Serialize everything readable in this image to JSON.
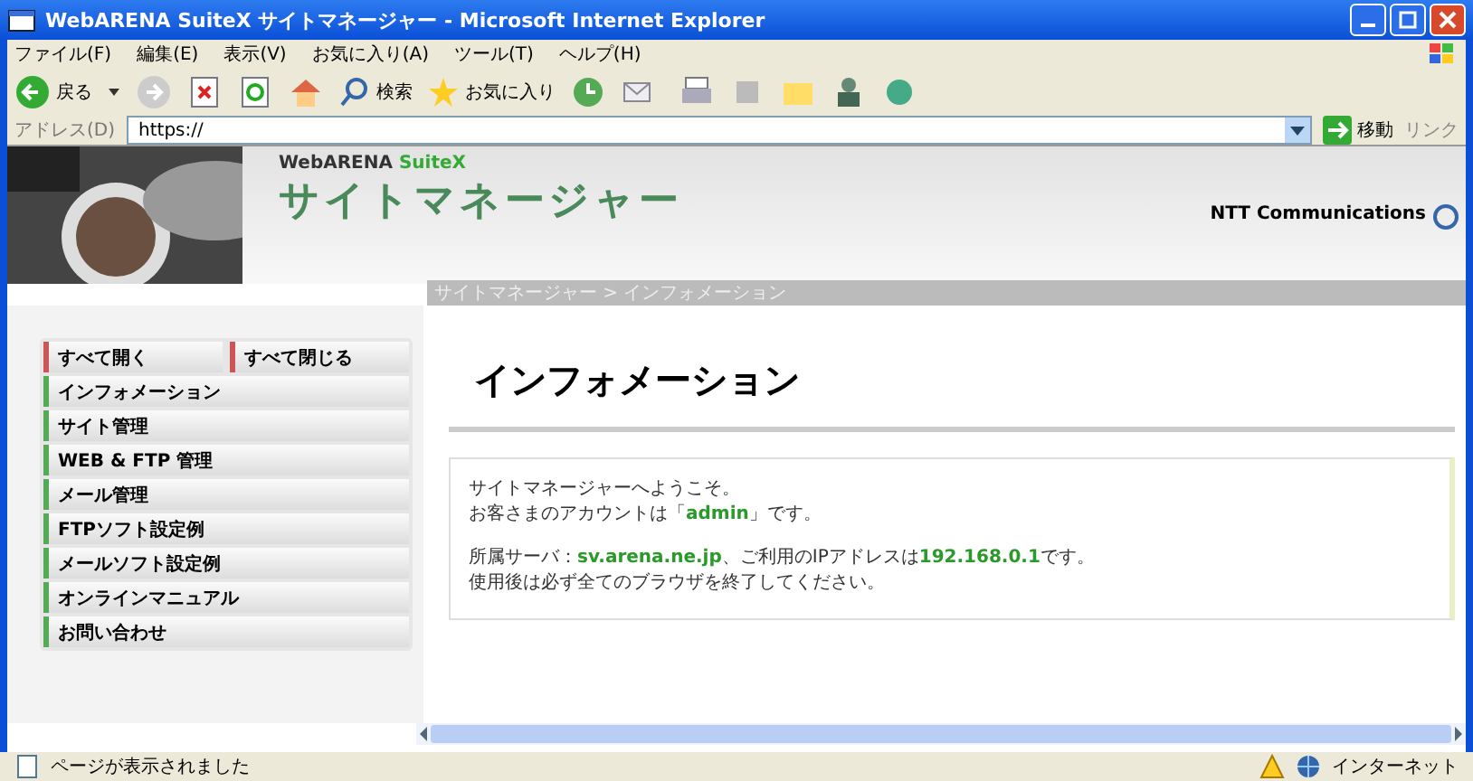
{
  "window": {
    "title": "WebARENA SuiteX サイトマネージャー - Microsoft Internet Explorer"
  },
  "menu": [
    "ファイル(F)",
    "編集(E)",
    "表示(V)",
    "お気に入り(A)",
    "ツール(T)",
    "ヘルプ(H)"
  ],
  "toolbar": {
    "back": "戻る",
    "search": "検索",
    "favorites": "お気に入り"
  },
  "address_bar": {
    "label": "アドレス(D)",
    "value": "https://",
    "go": "移動",
    "links": "リンク"
  },
  "site": {
    "brand": "WebARENA",
    "brand_suffix": "SuiteX",
    "title": "サイトマネージャー",
    "provider": "NTT Communications",
    "breadcrumb": "サイトマネージャー > インフォメーション"
  },
  "sidebar": {
    "toggles": [
      "すべて開く",
      "すべて閉じる"
    ],
    "items": [
      "インフォメーション",
      "サイト管理",
      "WEB & FTP 管理",
      "メール管理",
      "FTPソフト設定例",
      "メールソフト設定例",
      "オンラインマニュアル",
      "お問い合わせ"
    ]
  },
  "content": {
    "heading": "インフォメーション",
    "paragraphs": [
      [
        [
          {
            "kind": "text",
            "text": "サイトマネージャーへようこそ。"
          }
        ],
        [
          {
            "kind": "text",
            "text": "お客さまのアカウントは「"
          },
          {
            "kind": "link",
            "text": "admin"
          },
          {
            "kind": "text",
            "text": "」です。"
          }
        ]
      ],
      [
        [
          {
            "kind": "text",
            "text": "所属サーバ："
          },
          {
            "kind": "link",
            "text": "sv.arena.ne.jp"
          },
          {
            "kind": "text",
            "text": "、ご利用のIPアドレスは"
          },
          {
            "kind": "link",
            "text": "192.168.0.1"
          },
          {
            "kind": "text",
            "text": "です。"
          }
        ],
        [
          {
            "kind": "text",
            "text": "使用後は必ず全てのブラウザを終了してください。"
          }
        ]
      ]
    ]
  },
  "status_bar": {
    "text": "ページが表示されました",
    "zone": "インターネット"
  }
}
